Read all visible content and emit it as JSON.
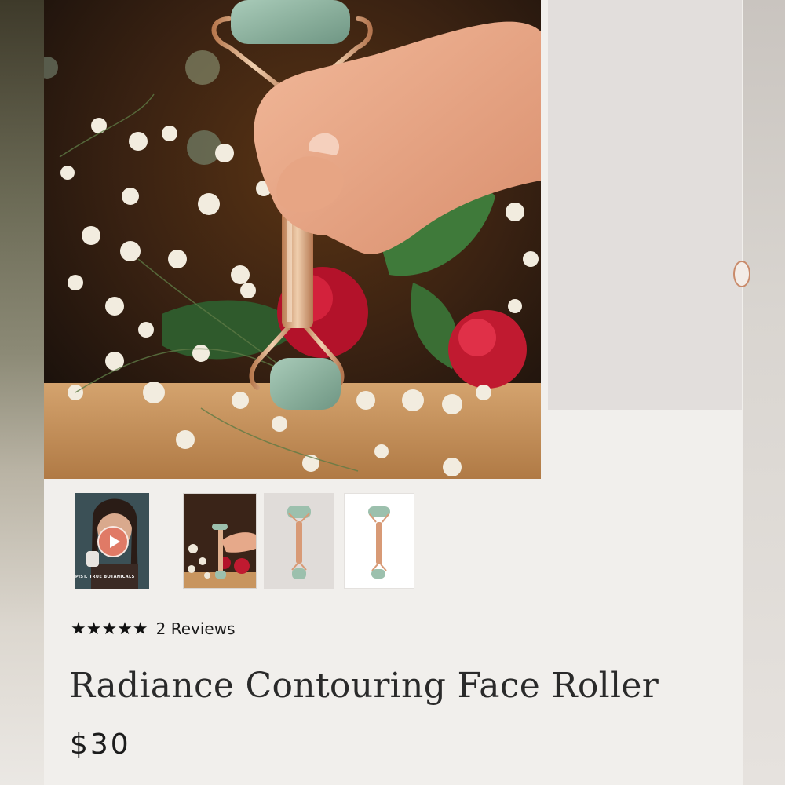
{
  "gallery": {
    "main_image_alt": "Hand holding jade face roller among flowers",
    "thumbnails": [
      {
        "kind": "video",
        "caption": "PIST. TRUE BOTANICALS"
      },
      {
        "kind": "image",
        "alt": "Roller with flowers"
      },
      {
        "kind": "image",
        "alt": "Roller on grey background"
      },
      {
        "kind": "image",
        "alt": "Roller on white background"
      }
    ]
  },
  "product": {
    "rating_stars": "★★★★★",
    "rating_value": 5,
    "reviews_label": "2 Reviews",
    "title": "Radiance Contouring Face Roller",
    "price": "$30"
  },
  "colors": {
    "background": "#f1efec",
    "text": "#2a2a2a",
    "rose_gold": "#d49b78",
    "jade": "#8fb3a1",
    "play_button": "#e07a66"
  },
  "icons": [
    "star-icon",
    "play-icon",
    "chevron-right-icon"
  ]
}
